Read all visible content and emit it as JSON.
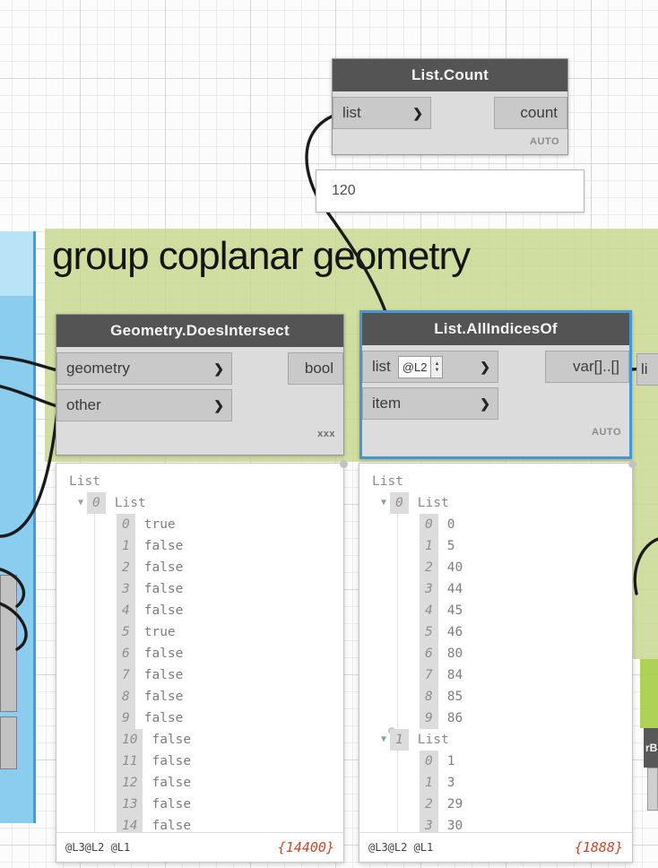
{
  "group": {
    "title": "group coplanar geometry"
  },
  "nodes": {
    "list_count": {
      "title": "List.Count",
      "input": "list",
      "output": "count",
      "lacing": "AUTO"
    },
    "does_intersect": {
      "title": "Geometry.DoesIntersect",
      "input1": "geometry",
      "input2": "other",
      "output": "bool",
      "lacing": "xxx"
    },
    "all_indices": {
      "title": "List.AllIndicesOf",
      "input1": "list",
      "input1_level": "@L2",
      "input2": "item",
      "output": "var[]..[]",
      "lacing": "AUTO"
    },
    "partial_right_input": "li",
    "partial_bottom_header": "rB"
  },
  "watch": {
    "value": "120"
  },
  "icons": {
    "port_chevron": "❯",
    "expander": "▼",
    "spin_up": "▲",
    "spin_down": "▼"
  },
  "previews": {
    "left": {
      "root": "List",
      "group0": {
        "index": "0",
        "label": "List"
      },
      "rows": [
        {
          "i": "0",
          "v": "true"
        },
        {
          "i": "1",
          "v": "false"
        },
        {
          "i": "2",
          "v": "false"
        },
        {
          "i": "3",
          "v": "false"
        },
        {
          "i": "4",
          "v": "false"
        },
        {
          "i": "5",
          "v": "true"
        },
        {
          "i": "6",
          "v": "false"
        },
        {
          "i": "7",
          "v": "false"
        },
        {
          "i": "8",
          "v": "false"
        },
        {
          "i": "9",
          "v": "false"
        },
        {
          "i": "10",
          "v": "false"
        },
        {
          "i": "11",
          "v": "false"
        },
        {
          "i": "12",
          "v": "false"
        },
        {
          "i": "13",
          "v": "false"
        },
        {
          "i": "14",
          "v": "false"
        }
      ],
      "levels": "@L3@L2 @L1",
      "count": "{14400}"
    },
    "right": {
      "root": "List",
      "group0": {
        "index": "0",
        "label": "List"
      },
      "rows0": [
        {
          "i": "0",
          "v": "0"
        },
        {
          "i": "1",
          "v": "5"
        },
        {
          "i": "2",
          "v": "40"
        },
        {
          "i": "3",
          "v": "44"
        },
        {
          "i": "4",
          "v": "45"
        },
        {
          "i": "5",
          "v": "46"
        },
        {
          "i": "6",
          "v": "80"
        },
        {
          "i": "7",
          "v": "84"
        },
        {
          "i": "8",
          "v": "85"
        },
        {
          "i": "9",
          "v": "86"
        }
      ],
      "group1": {
        "index": "1",
        "label": "List"
      },
      "rows1": [
        {
          "i": "0",
          "v": "1"
        },
        {
          "i": "1",
          "v": "3"
        },
        {
          "i": "2",
          "v": "29"
        },
        {
          "i": "3",
          "v": "30"
        }
      ],
      "levels": "@L3@L2 @L1",
      "count": "{1888}"
    }
  },
  "colors": {
    "group_green": "#c7d78d",
    "accent_blue": "#4596d1",
    "bright_green": "#a4cd42",
    "strip_blue": "#8bcdee"
  }
}
